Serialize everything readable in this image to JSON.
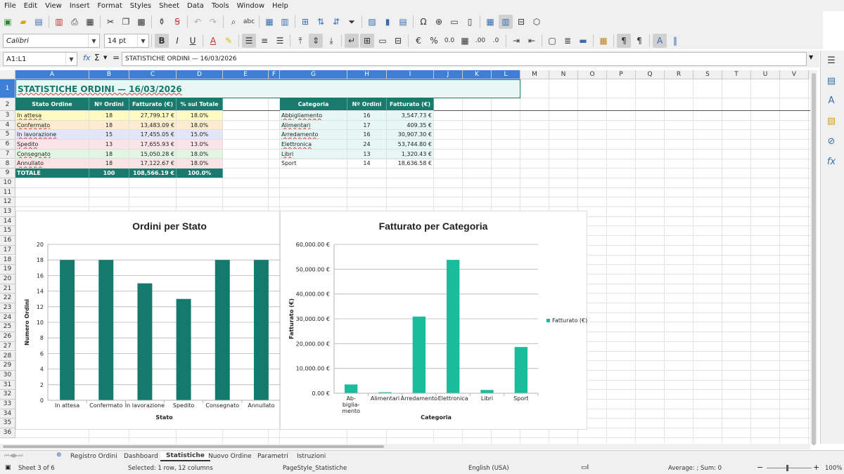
{
  "menu": [
    "File",
    "Edit",
    "View",
    "Insert",
    "Format",
    "Styles",
    "Sheet",
    "Data",
    "Tools",
    "Window",
    "Help"
  ],
  "font_name": "Calibri",
  "font_size": "14 pt",
  "name_box": "A1:L1",
  "formula": "STATISTICHE ORDINI — 16/03/2026",
  "columns": [
    "A",
    "B",
    "C",
    "D",
    "E",
    "F",
    "G",
    "H",
    "I",
    "J",
    "K",
    "L",
    "M",
    "N",
    "O",
    "P",
    "Q",
    "R",
    "S",
    "T",
    "U",
    "V"
  ],
  "rows": [
    "1",
    "2",
    "3",
    "4",
    "5",
    "6",
    "7",
    "8",
    "9",
    "10",
    "11",
    "12",
    "13",
    "14",
    "15",
    "16",
    "17",
    "18",
    "19",
    "20",
    "21",
    "22",
    "23",
    "24",
    "25",
    "26",
    "27",
    "28",
    "29",
    "30",
    "31",
    "32",
    "33",
    "34",
    "35",
    "36"
  ],
  "sheet": {
    "title": "STATISTICHE ORDINI — 16/03/2026",
    "status_table": {
      "headers": [
        "Stato Ordine",
        "Nº Ordini",
        "Fatturato (€)",
        "% sul Totale"
      ],
      "rows": [
        [
          "In attesa",
          "18",
          "27,799.17 €",
          "18.0%"
        ],
        [
          "Confermato",
          "18",
          "13,483.09 €",
          "18.0%"
        ],
        [
          "In lavorazione",
          "15",
          "17,455.05 €",
          "15.0%"
        ],
        [
          "Spedito",
          "13",
          "17,655.93 €",
          "13.0%"
        ],
        [
          "Consegnato",
          "18",
          "15,050.28 €",
          "18.0%"
        ],
        [
          "Annullato",
          "18",
          "17,122.67 €",
          "18.0%"
        ]
      ],
      "total": [
        "TOTALE",
        "100",
        "108,566.19 €",
        "100.0%"
      ],
      "row_colors": [
        "#fff9c4",
        "#fdebd0",
        "#e3e6f8",
        "#fbe3ea",
        "#e2f5e3",
        "#fbe3e3"
      ]
    },
    "category_table": {
      "headers": [
        "Categoria",
        "Nº Ordini",
        "Fatturato (€)"
      ],
      "rows": [
        [
          "Abbigliamento",
          "16",
          "3,547.73 €"
        ],
        [
          "Alimentari",
          "17",
          "409.35 €"
        ],
        [
          "Arredamento",
          "16",
          "30,907.30 €"
        ],
        [
          "Elettronica",
          "24",
          "53,744.80 €"
        ],
        [
          "Libri",
          "13",
          "1,320.43 €"
        ],
        [
          "Sport",
          "14",
          "18,636.58 €"
        ]
      ],
      "row_colors": [
        "#e6f7f4",
        "#e6f7f4",
        "#e6f7f4",
        "#e6f7f4",
        "#e6f7f4",
        "#ffffff"
      ]
    }
  },
  "chart_data": [
    {
      "type": "bar",
      "title": "Ordini per Stato",
      "xlabel": "Stato",
      "ylabel": "Numero Ordini",
      "categories": [
        "In attesa",
        "Confermato",
        "In lavorazione",
        "Spedito",
        "Consegnato",
        "Annullato"
      ],
      "values": [
        18,
        18,
        15,
        13,
        18,
        18
      ],
      "ylim": [
        0,
        20
      ],
      "yticks": [
        "0",
        "2",
        "4",
        "6",
        "8",
        "10",
        "12",
        "14",
        "16",
        "18",
        "20"
      ],
      "color": "#157a6e",
      "grid": true,
      "legend": "none"
    },
    {
      "type": "bar",
      "title": "Fatturato per Categoria",
      "xlabel": "Categoria",
      "ylabel": "Fatturato (€)",
      "categories": [
        "Ab-\nbiglia-\nmento",
        "Alimentari",
        "Arredamento",
        "Elettronica",
        "Libri",
        "Sport"
      ],
      "values": [
        3547.73,
        409.35,
        30907.3,
        53744.8,
        1320.43,
        18636.58
      ],
      "ylim": [
        0,
        60000
      ],
      "yticks": [
        "0.00 €",
        "10,000.00 €",
        "20,000.00 €",
        "30,000.00 €",
        "40,000.00 €",
        "50,000.00 €",
        "60,000.00 €"
      ],
      "series": [
        {
          "name": "Fatturato (€)",
          "values": [
            3547.73,
            409.35,
            30907.3,
            53744.8,
            1320.43,
            18636.58
          ]
        }
      ],
      "color": "#1abc9c",
      "grid": true,
      "legend": "right"
    }
  ],
  "sheet_tabs": [
    "Registro Ordini",
    "Dashboard",
    "Statistiche",
    "Nuovo Ordine",
    "Parametri",
    "Istruzioni"
  ],
  "active_tab": "Statistiche",
  "status": {
    "sheet": "Sheet 3 of 6",
    "selection": "Selected: 1 row, 12 columns",
    "page_style": "PageStyle_Statistiche",
    "language": "English (USA)",
    "sum": "Average: ; Sum: 0",
    "zoom": "100%"
  }
}
